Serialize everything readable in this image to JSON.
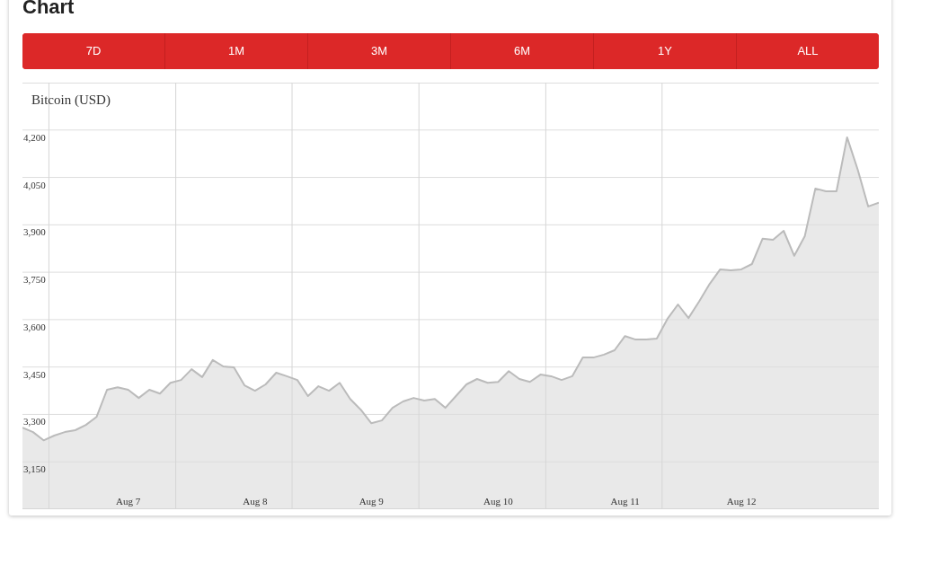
{
  "title": "Chart",
  "range_buttons": [
    {
      "label": "7D"
    },
    {
      "label": "1M"
    },
    {
      "label": "3M"
    },
    {
      "label": "6M"
    },
    {
      "label": "1Y"
    },
    {
      "label": "ALL"
    }
  ],
  "chart_data": {
    "type": "area",
    "title": "Bitcoin (USD)",
    "ylim": [
      3000,
      4350
    ],
    "grid": true,
    "yticks": [
      {
        "value": 3150,
        "label": "3,150"
      },
      {
        "value": 3300,
        "label": "3,300"
      },
      {
        "value": 3450,
        "label": "3,450"
      },
      {
        "value": 3600,
        "label": "3,600"
      },
      {
        "value": 3750,
        "label": "3,750"
      },
      {
        "value": 3900,
        "label": "3,900"
      },
      {
        "value": 4050,
        "label": "4,050"
      },
      {
        "value": 4200,
        "label": "4,200"
      }
    ],
    "categories": [
      null,
      null,
      null,
      null,
      null,
      null,
      null,
      null,
      null,
      null,
      "Aug 7",
      null,
      null,
      null,
      null,
      null,
      null,
      null,
      null,
      null,
      null,
      null,
      "Aug 8",
      null,
      null,
      null,
      null,
      null,
      null,
      null,
      null,
      null,
      null,
      "Aug 9",
      null,
      null,
      null,
      null,
      null,
      null,
      null,
      null,
      null,
      null,
      null,
      "Aug 10",
      null,
      null,
      null,
      null,
      null,
      null,
      null,
      null,
      null,
      null,
      null,
      "Aug 11",
      null,
      null,
      null,
      null,
      null,
      null,
      null,
      null,
      null,
      null,
      "Aug 12",
      null,
      null,
      null,
      null,
      null,
      null,
      null,
      null,
      null,
      null,
      null,
      null,
      null
    ],
    "series": [
      {
        "color": "#bbbbbb",
        "values": [
          3258,
          3244,
          3218,
          3233,
          3244,
          3250,
          3267,
          3292,
          3378,
          3386,
          3378,
          3352,
          3378,
          3366,
          3400,
          3409,
          3443,
          3418,
          3472,
          3452,
          3449,
          3392,
          3375,
          3395,
          3432,
          3421,
          3409,
          3358,
          3389,
          3375,
          3400,
          3349,
          3315,
          3272,
          3281,
          3321,
          3341,
          3352,
          3344,
          3349,
          3321,
          3358,
          3395,
          3412,
          3400,
          3403,
          3437,
          3412,
          3403,
          3426,
          3421,
          3409,
          3421,
          3480,
          3480,
          3489,
          3503,
          3548,
          3537,
          3537,
          3540,
          3602,
          3648,
          3605,
          3657,
          3713,
          3759,
          3756,
          3759,
          3776,
          3856,
          3853,
          3881,
          3802,
          3864,
          4015,
          4006,
          4006,
          4177,
          4075,
          3958,
          3970
        ]
      }
    ]
  }
}
